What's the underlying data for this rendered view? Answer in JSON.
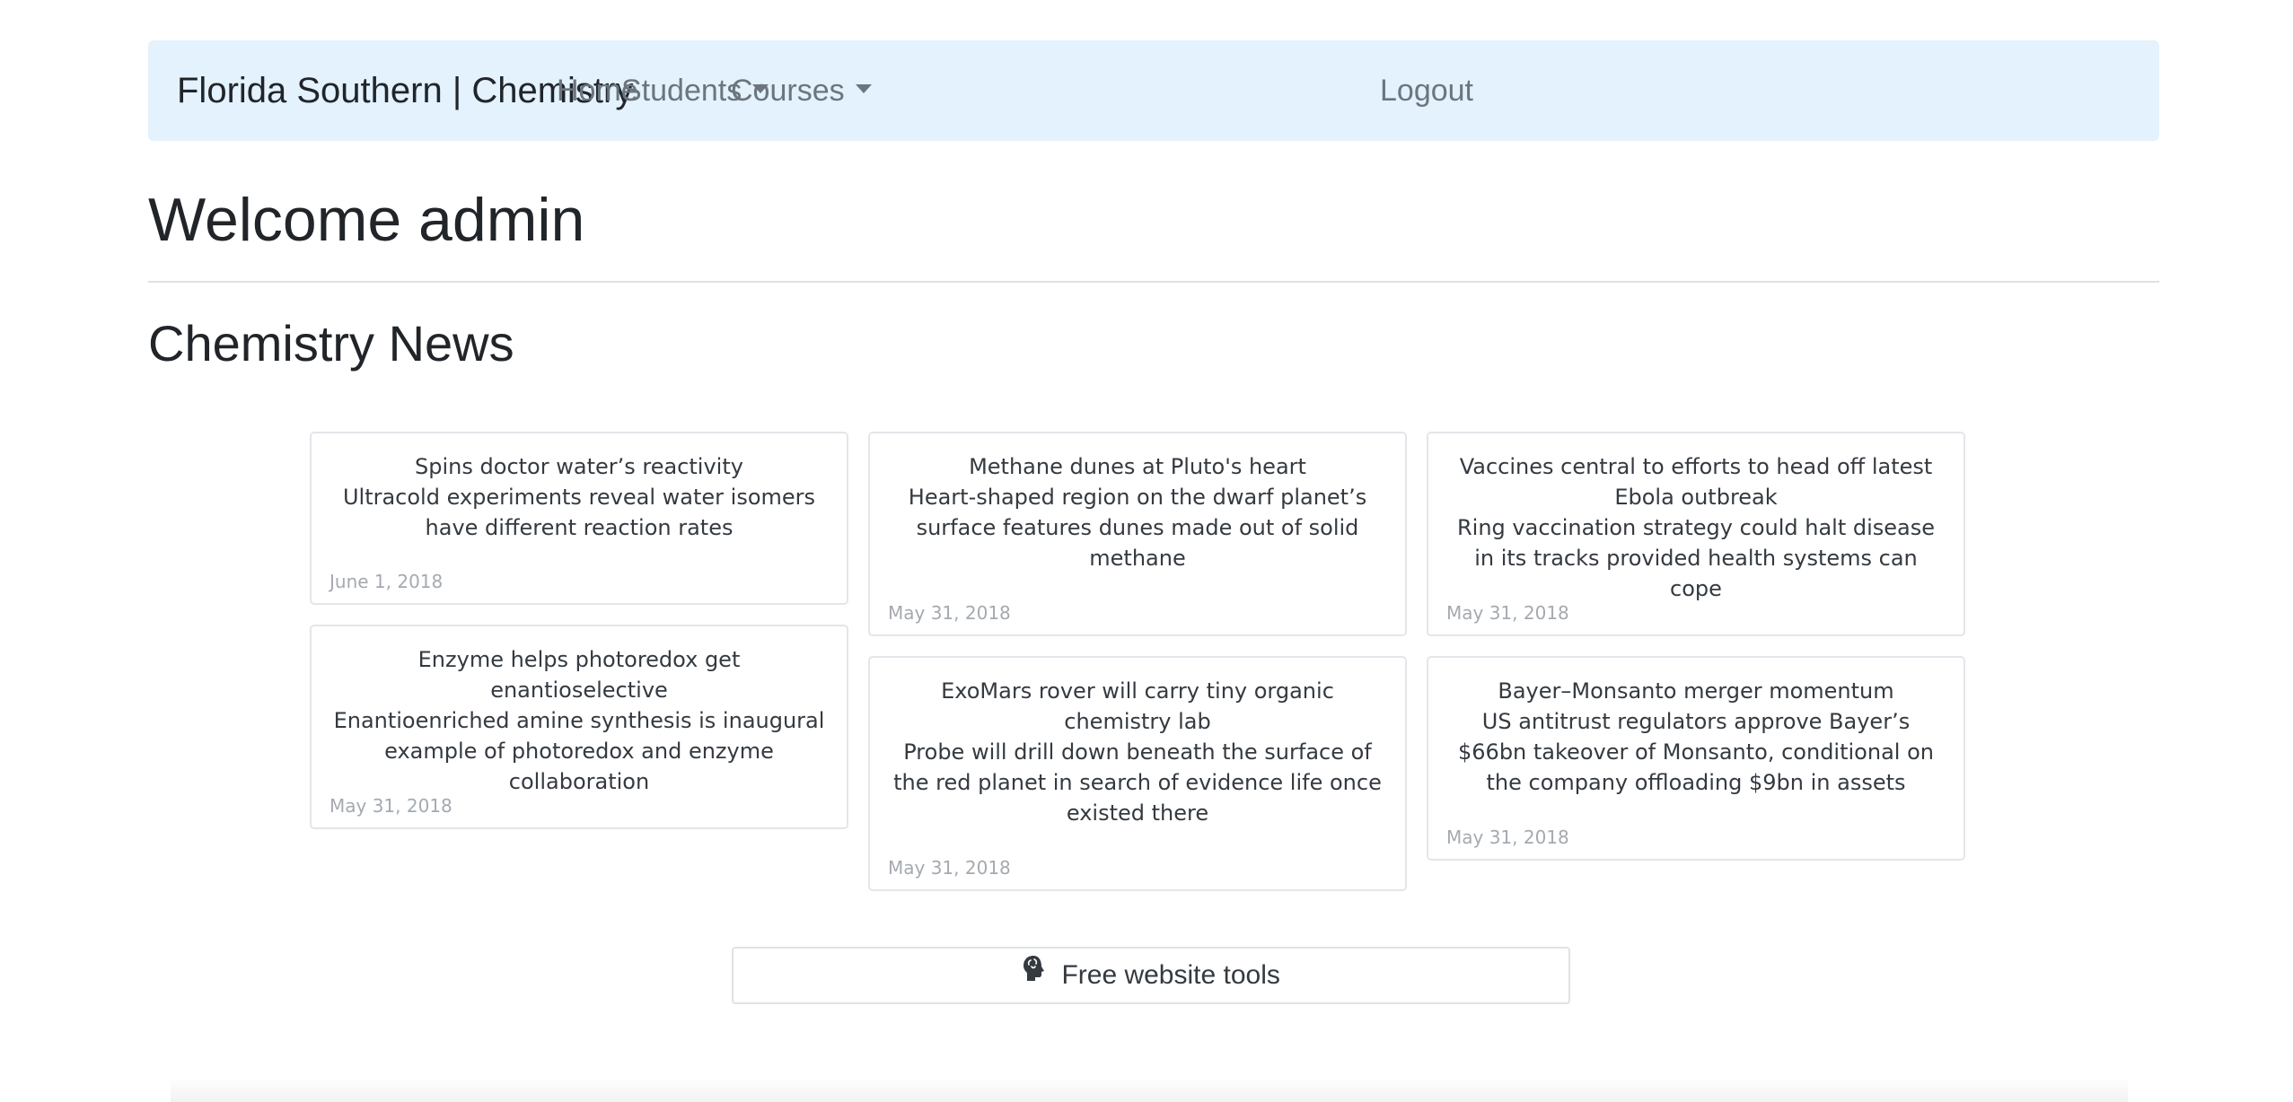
{
  "navbar": {
    "brand": "Florida Southern | Chemistry",
    "home": "Home",
    "students": "Students",
    "courses": "Courses",
    "logout": "Logout"
  },
  "page": {
    "welcome": "Welcome admin",
    "news_heading": "Chemistry News"
  },
  "cards": [
    {
      "title": "Spins doctor water’s reactivity",
      "summary": "Ultracold experiments reveal water isomers have different reaction rates",
      "date": "June 1, 2018"
    },
    {
      "title": "Methane dunes at Pluto's heart",
      "summary": "Heart-shaped region on the dwarf planet’s surface features dunes made out of solid methane",
      "date": "May 31, 2018"
    },
    {
      "title": "Vaccines central to efforts to head off latest Ebola outbreak",
      "summary": "Ring vaccination strategy could halt disease in its tracks provided health systems can cope",
      "date": "May 31, 2018"
    },
    {
      "title": "Enzyme helps photoredox get enantioselective",
      "summary": "Enantioenriched amine synthesis is inaugural example of photoredox and enzyme collaboration",
      "date": "May 31, 2018"
    },
    {
      "title": "ExoMars rover will carry tiny organic chemistry lab",
      "summary": "Probe will drill down beneath the surface of the red planet in search of evidence life once existed there",
      "date": "May 31, 2018"
    },
    {
      "title": "Bayer–Monsanto merger momentum",
      "summary": "US antitrust regulators approve Bayer’s $66bn takeover of Monsanto, conditional on the company offloading $9bn in assets",
      "date": "May 31, 2018"
    }
  ],
  "footer": {
    "tools_label": "Free website tools",
    "tools_icon": "brain-head-icon"
  },
  "colors": {
    "navbar_bg": "#e3f2fd",
    "nav_link": "#6c757d",
    "date_text": "#a4aab0"
  }
}
